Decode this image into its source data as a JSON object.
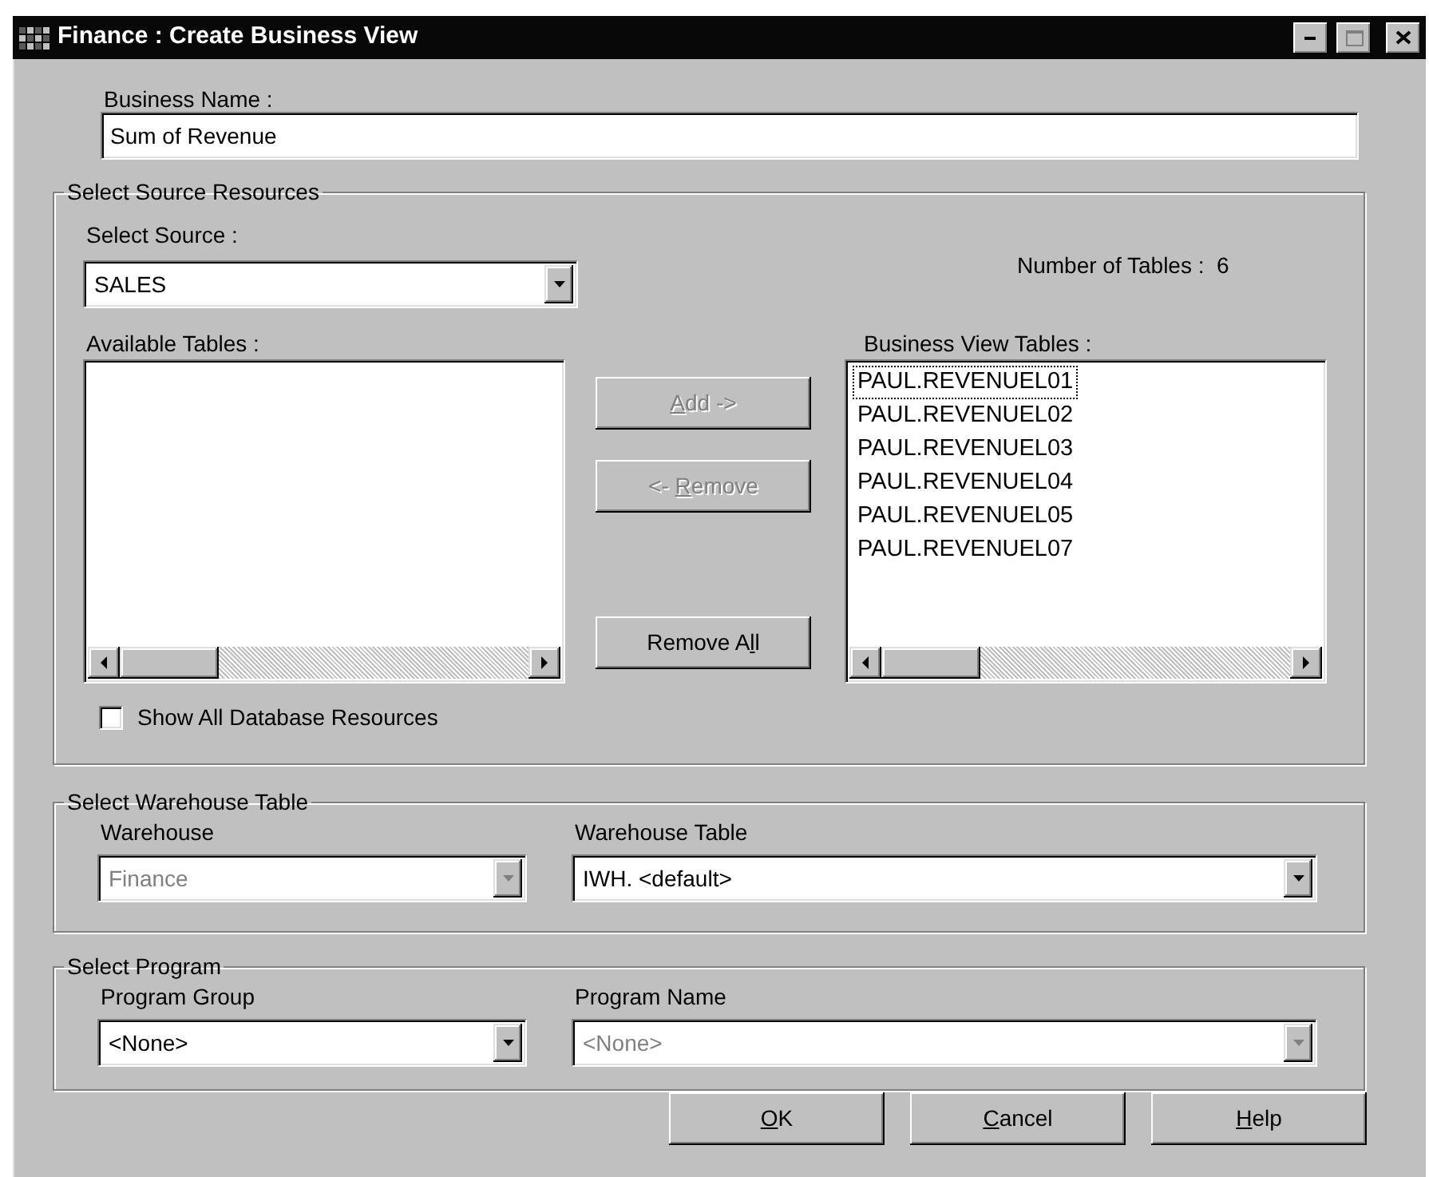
{
  "window": {
    "title": "Finance : Create Business View"
  },
  "business_name": {
    "label": "Business Name :",
    "value": "Sum of Revenue"
  },
  "source_group": {
    "title": "Select Source Resources",
    "source_label": "Select Source :",
    "source": {
      "value": "SALES",
      "disabled": false
    },
    "table_count": "Number of Tables :  6",
    "available_label": "Available Tables :",
    "view_label": "Business View Tables :",
    "view_tables": [
      {
        "name": "PAUL.REVENUEL01",
        "focused": true
      },
      {
        "name": "PAUL.REVENUEL02",
        "focused": false
      },
      {
        "name": "PAUL.REVENUEL03",
        "focused": false
      },
      {
        "name": "PAUL.REVENUEL04",
        "focused": false
      },
      {
        "name": "PAUL.REVENUEL05",
        "focused": false
      },
      {
        "name": "PAUL.REVENUEL07",
        "focused": false
      }
    ],
    "buttons": [
      {
        "key": "A",
        "after": "dd ->",
        "disabled": true
      },
      {
        "before": "<- ",
        "key": "R",
        "after": "emove",
        "disabled": true
      },
      {
        "before": "Remove A",
        "key": "l",
        "after": "l",
        "disabled": false
      }
    ],
    "show_all": {
      "label": "Show All Database Resources",
      "checked": false
    }
  },
  "warehouse_group": {
    "title": "Select Warehouse Table",
    "fields": [
      {
        "label": "Warehouse",
        "value": "Finance",
        "disabled": true
      },
      {
        "label": "Warehouse Table",
        "value": "IWH. <default>",
        "disabled": false
      }
    ]
  },
  "program_group": {
    "title": "Select Program",
    "fields": [
      {
        "label": "Program Group",
        "value": "<None>",
        "disabled": false
      },
      {
        "label": "Program Name",
        "value": "<None>",
        "disabled": true
      }
    ]
  },
  "dialog_buttons": [
    {
      "key": "O",
      "after": "K",
      "disabled": false
    },
    {
      "key": "C",
      "after": "ancel",
      "disabled": false
    },
    {
      "key": "H",
      "after": "elp",
      "disabled": false
    }
  ]
}
